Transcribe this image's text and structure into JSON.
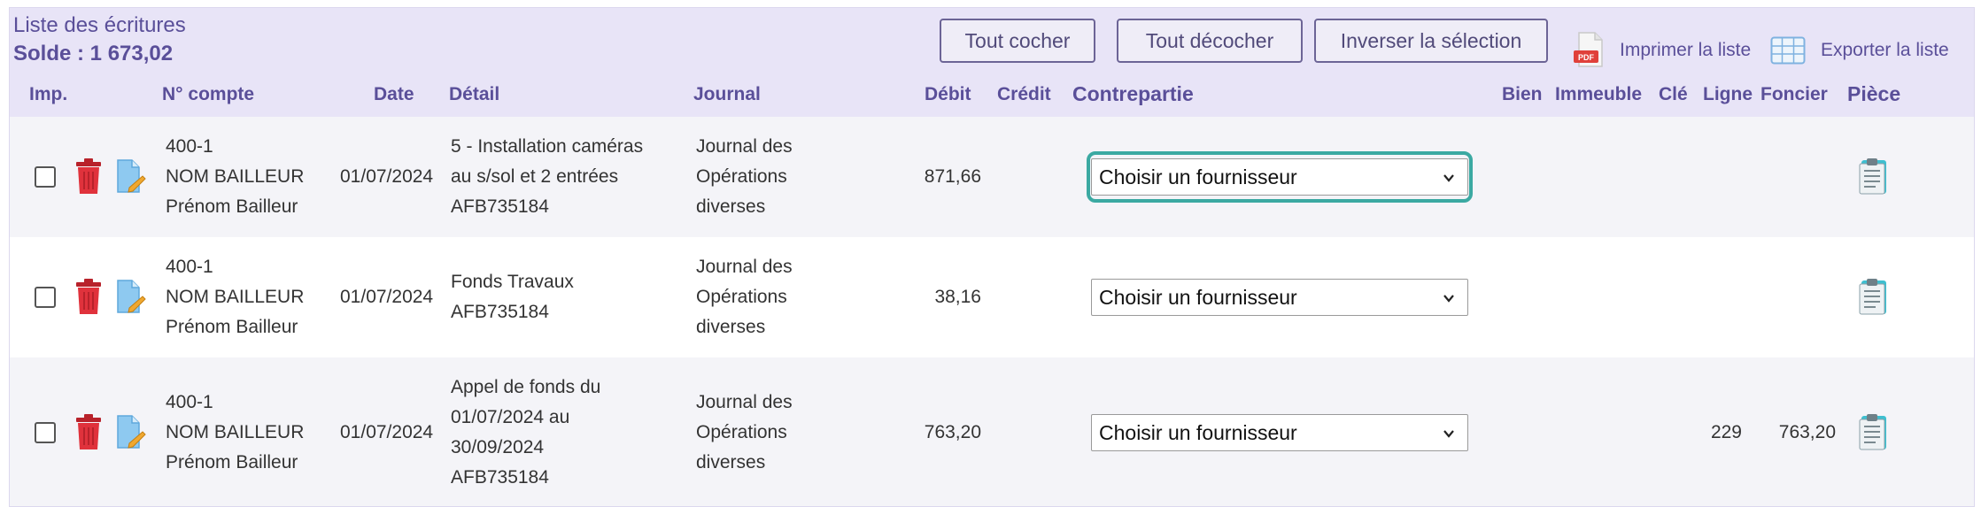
{
  "header": {
    "title": "Liste des écritures",
    "balance": "Solde : 1 673,02"
  },
  "toolbar": {
    "check_all": "Tout cocher",
    "uncheck_all": "Tout décocher",
    "invert_selection": "Inverser la sélection",
    "print_list": "Imprimer la liste",
    "export_list": "Exporter la liste",
    "pdf_badge": "PDF"
  },
  "columns": {
    "imp": "Imp.",
    "account": "N° compte",
    "date": "Date",
    "detail": "Détail",
    "journal": "Journal",
    "debit": "Débit",
    "credit": "Crédit",
    "counterpart": "Contrepartie",
    "property": "Bien",
    "building": "Immeuble",
    "key": "Clé",
    "line": "Ligne",
    "land": "Foncier",
    "document": "Pièce"
  },
  "rows": [
    {
      "account": [
        "400-1",
        "NOM BAILLEUR",
        "Prénom Bailleur"
      ],
      "date": "01/07/2024",
      "detail": [
        "5 - Installation caméras",
        "au s/sol et 2 entrées",
        "AFB735184"
      ],
      "journal": [
        "Journal des",
        "Opérations",
        "diverses"
      ],
      "debit": "871,66",
      "credit": "",
      "counterpart": "Choisir un fournisseur",
      "property": "",
      "building": "",
      "key": "",
      "line": "",
      "land": "",
      "checked": false,
      "focused": true
    },
    {
      "account": [
        "400-1",
        "NOM BAILLEUR",
        "Prénom Bailleur"
      ],
      "date": "01/07/2024",
      "detail": [
        "Fonds Travaux",
        "AFB735184"
      ],
      "journal": [
        "Journal des",
        "Opérations",
        "diverses"
      ],
      "debit": "38,16",
      "credit": "",
      "counterpart": "Choisir un fournisseur",
      "property": "",
      "building": "",
      "key": "",
      "line": "",
      "land": "",
      "checked": false,
      "focused": false
    },
    {
      "account": [
        "400-1",
        "NOM BAILLEUR",
        "Prénom Bailleur"
      ],
      "date": "01/07/2024",
      "detail": [
        "Appel de fonds du",
        "01/07/2024 au",
        "30/09/2024",
        "AFB735184"
      ],
      "journal": [
        "Journal des",
        "Opérations",
        "diverses"
      ],
      "debit": "763,20",
      "credit": "",
      "counterpart": "Choisir un fournisseur",
      "property": "",
      "building": "",
      "key": "",
      "line": "229",
      "land": "763,20",
      "checked": false,
      "focused": false
    }
  ],
  "colors": {
    "header_bg": "#e8e4f7",
    "header_text": "#5a4f99",
    "focus_ring": "#3ba9a2",
    "trash_red": "#d9303a",
    "doc_blue": "#7fc0ec"
  },
  "icons": [
    "pdf-file-icon",
    "spreadsheet-grid-icon",
    "trash-icon",
    "edit-document-icon",
    "clipboard-icon",
    "chevron-down-icon"
  ]
}
